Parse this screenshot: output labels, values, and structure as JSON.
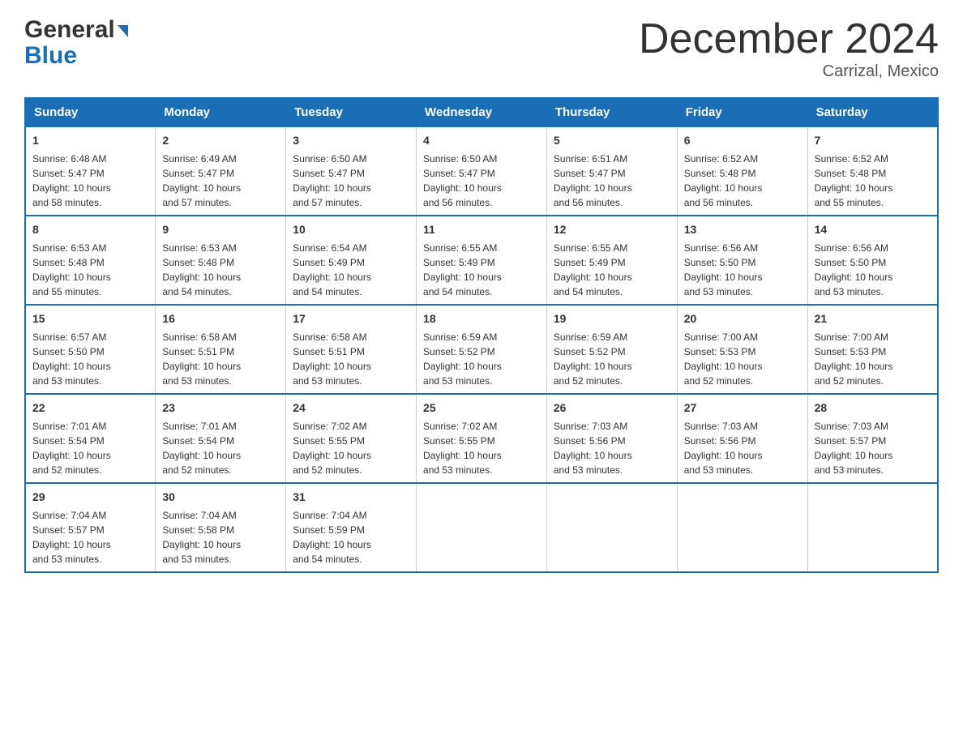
{
  "header": {
    "logo_general": "General",
    "logo_blue": "Blue",
    "title": "December 2024",
    "location": "Carrizal, Mexico"
  },
  "weekdays": [
    "Sunday",
    "Monday",
    "Tuesday",
    "Wednesday",
    "Thursday",
    "Friday",
    "Saturday"
  ],
  "weeks": [
    [
      {
        "day": "1",
        "sunrise": "6:48 AM",
        "sunset": "5:47 PM",
        "daylight": "10 hours and 58 minutes."
      },
      {
        "day": "2",
        "sunrise": "6:49 AM",
        "sunset": "5:47 PM",
        "daylight": "10 hours and 57 minutes."
      },
      {
        "day": "3",
        "sunrise": "6:50 AM",
        "sunset": "5:47 PM",
        "daylight": "10 hours and 57 minutes."
      },
      {
        "day": "4",
        "sunrise": "6:50 AM",
        "sunset": "5:47 PM",
        "daylight": "10 hours and 56 minutes."
      },
      {
        "day": "5",
        "sunrise": "6:51 AM",
        "sunset": "5:47 PM",
        "daylight": "10 hours and 56 minutes."
      },
      {
        "day": "6",
        "sunrise": "6:52 AM",
        "sunset": "5:48 PM",
        "daylight": "10 hours and 56 minutes."
      },
      {
        "day": "7",
        "sunrise": "6:52 AM",
        "sunset": "5:48 PM",
        "daylight": "10 hours and 55 minutes."
      }
    ],
    [
      {
        "day": "8",
        "sunrise": "6:53 AM",
        "sunset": "5:48 PM",
        "daylight": "10 hours and 55 minutes."
      },
      {
        "day": "9",
        "sunrise": "6:53 AM",
        "sunset": "5:48 PM",
        "daylight": "10 hours and 54 minutes."
      },
      {
        "day": "10",
        "sunrise": "6:54 AM",
        "sunset": "5:49 PM",
        "daylight": "10 hours and 54 minutes."
      },
      {
        "day": "11",
        "sunrise": "6:55 AM",
        "sunset": "5:49 PM",
        "daylight": "10 hours and 54 minutes."
      },
      {
        "day": "12",
        "sunrise": "6:55 AM",
        "sunset": "5:49 PM",
        "daylight": "10 hours and 54 minutes."
      },
      {
        "day": "13",
        "sunrise": "6:56 AM",
        "sunset": "5:50 PM",
        "daylight": "10 hours and 53 minutes."
      },
      {
        "day": "14",
        "sunrise": "6:56 AM",
        "sunset": "5:50 PM",
        "daylight": "10 hours and 53 minutes."
      }
    ],
    [
      {
        "day": "15",
        "sunrise": "6:57 AM",
        "sunset": "5:50 PM",
        "daylight": "10 hours and 53 minutes."
      },
      {
        "day": "16",
        "sunrise": "6:58 AM",
        "sunset": "5:51 PM",
        "daylight": "10 hours and 53 minutes."
      },
      {
        "day": "17",
        "sunrise": "6:58 AM",
        "sunset": "5:51 PM",
        "daylight": "10 hours and 53 minutes."
      },
      {
        "day": "18",
        "sunrise": "6:59 AM",
        "sunset": "5:52 PM",
        "daylight": "10 hours and 53 minutes."
      },
      {
        "day": "19",
        "sunrise": "6:59 AM",
        "sunset": "5:52 PM",
        "daylight": "10 hours and 52 minutes."
      },
      {
        "day": "20",
        "sunrise": "7:00 AM",
        "sunset": "5:53 PM",
        "daylight": "10 hours and 52 minutes."
      },
      {
        "day": "21",
        "sunrise": "7:00 AM",
        "sunset": "5:53 PM",
        "daylight": "10 hours and 52 minutes."
      }
    ],
    [
      {
        "day": "22",
        "sunrise": "7:01 AM",
        "sunset": "5:54 PM",
        "daylight": "10 hours and 52 minutes."
      },
      {
        "day": "23",
        "sunrise": "7:01 AM",
        "sunset": "5:54 PM",
        "daylight": "10 hours and 52 minutes."
      },
      {
        "day": "24",
        "sunrise": "7:02 AM",
        "sunset": "5:55 PM",
        "daylight": "10 hours and 52 minutes."
      },
      {
        "day": "25",
        "sunrise": "7:02 AM",
        "sunset": "5:55 PM",
        "daylight": "10 hours and 53 minutes."
      },
      {
        "day": "26",
        "sunrise": "7:03 AM",
        "sunset": "5:56 PM",
        "daylight": "10 hours and 53 minutes."
      },
      {
        "day": "27",
        "sunrise": "7:03 AM",
        "sunset": "5:56 PM",
        "daylight": "10 hours and 53 minutes."
      },
      {
        "day": "28",
        "sunrise": "7:03 AM",
        "sunset": "5:57 PM",
        "daylight": "10 hours and 53 minutes."
      }
    ],
    [
      {
        "day": "29",
        "sunrise": "7:04 AM",
        "sunset": "5:57 PM",
        "daylight": "10 hours and 53 minutes."
      },
      {
        "day": "30",
        "sunrise": "7:04 AM",
        "sunset": "5:58 PM",
        "daylight": "10 hours and 53 minutes."
      },
      {
        "day": "31",
        "sunrise": "7:04 AM",
        "sunset": "5:59 PM",
        "daylight": "10 hours and 54 minutes."
      },
      null,
      null,
      null,
      null
    ]
  ],
  "labels": {
    "sunrise": "Sunrise:",
    "sunset": "Sunset:",
    "daylight": "Daylight:"
  }
}
